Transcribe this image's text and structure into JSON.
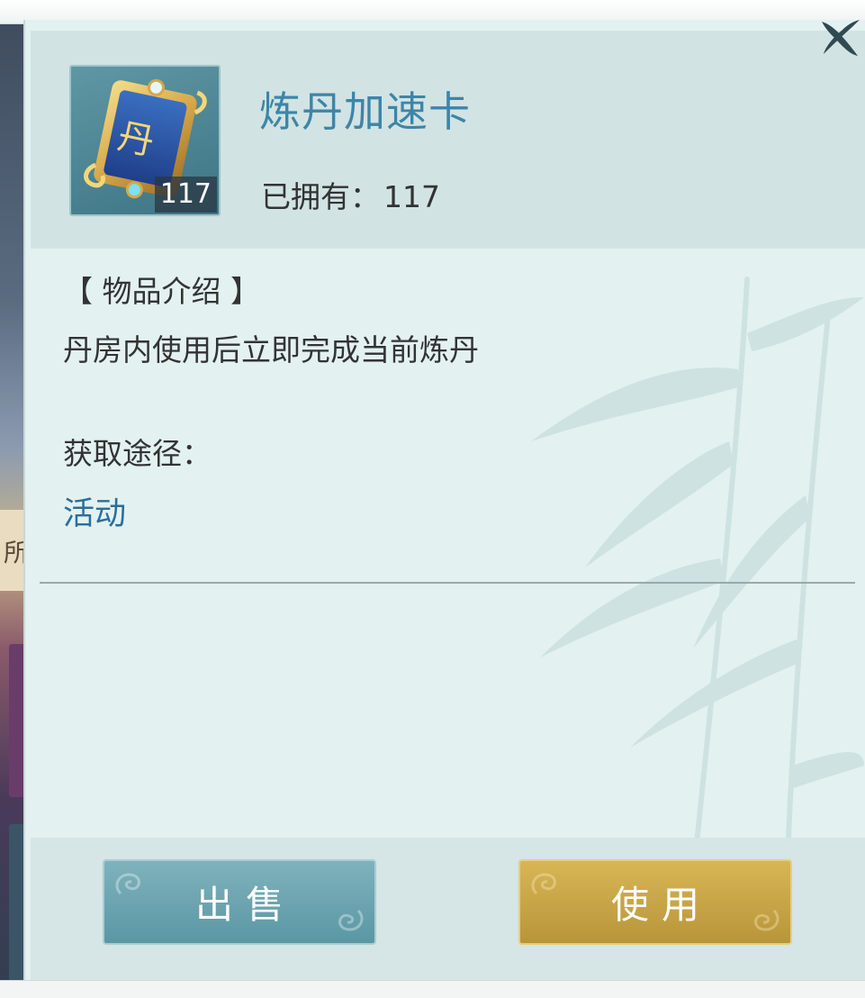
{
  "item": {
    "name": "炼丹加速卡",
    "icon": "elixir-card-icon",
    "icon_glyph": "丹",
    "count": "117",
    "owned_label": "已拥有：",
    "owned_value": "117"
  },
  "details": {
    "intro_label": "【 物品介绍 】",
    "description": "丹房内使用后立即完成当前炼丹",
    "source_label": "获取途径：",
    "source_link": "活动"
  },
  "actions": {
    "sell_label": "出售",
    "use_label": "使用"
  },
  "background": {
    "side_tab_text": "所"
  },
  "colors": {
    "title": "#3d85a8",
    "link": "#2a6f9a",
    "sell_button": "#6aa3af",
    "use_button": "#c9a646",
    "panel": "#e3f1f1"
  }
}
